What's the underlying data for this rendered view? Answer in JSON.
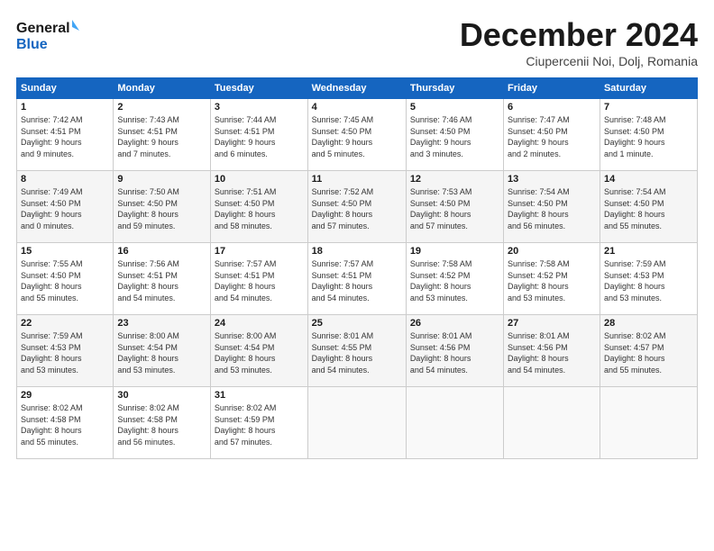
{
  "header": {
    "logo_line1": "General",
    "logo_line2": "Blue",
    "month_title": "December 2024",
    "location": "Ciupercenii Noi, Dolj, Romania"
  },
  "weekdays": [
    "Sunday",
    "Monday",
    "Tuesday",
    "Wednesday",
    "Thursday",
    "Friday",
    "Saturday"
  ],
  "weeks": [
    [
      {
        "day": "1",
        "info": "Sunrise: 7:42 AM\nSunset: 4:51 PM\nDaylight: 9 hours\nand 9 minutes."
      },
      {
        "day": "2",
        "info": "Sunrise: 7:43 AM\nSunset: 4:51 PM\nDaylight: 9 hours\nand 7 minutes."
      },
      {
        "day": "3",
        "info": "Sunrise: 7:44 AM\nSunset: 4:51 PM\nDaylight: 9 hours\nand 6 minutes."
      },
      {
        "day": "4",
        "info": "Sunrise: 7:45 AM\nSunset: 4:50 PM\nDaylight: 9 hours\nand 5 minutes."
      },
      {
        "day": "5",
        "info": "Sunrise: 7:46 AM\nSunset: 4:50 PM\nDaylight: 9 hours\nand 3 minutes."
      },
      {
        "day": "6",
        "info": "Sunrise: 7:47 AM\nSunset: 4:50 PM\nDaylight: 9 hours\nand 2 minutes."
      },
      {
        "day": "7",
        "info": "Sunrise: 7:48 AM\nSunset: 4:50 PM\nDaylight: 9 hours\nand 1 minute."
      }
    ],
    [
      {
        "day": "8",
        "info": "Sunrise: 7:49 AM\nSunset: 4:50 PM\nDaylight: 9 hours\nand 0 minutes."
      },
      {
        "day": "9",
        "info": "Sunrise: 7:50 AM\nSunset: 4:50 PM\nDaylight: 8 hours\nand 59 minutes."
      },
      {
        "day": "10",
        "info": "Sunrise: 7:51 AM\nSunset: 4:50 PM\nDaylight: 8 hours\nand 58 minutes."
      },
      {
        "day": "11",
        "info": "Sunrise: 7:52 AM\nSunset: 4:50 PM\nDaylight: 8 hours\nand 57 minutes."
      },
      {
        "day": "12",
        "info": "Sunrise: 7:53 AM\nSunset: 4:50 PM\nDaylight: 8 hours\nand 57 minutes."
      },
      {
        "day": "13",
        "info": "Sunrise: 7:54 AM\nSunset: 4:50 PM\nDaylight: 8 hours\nand 56 minutes."
      },
      {
        "day": "14",
        "info": "Sunrise: 7:54 AM\nSunset: 4:50 PM\nDaylight: 8 hours\nand 55 minutes."
      }
    ],
    [
      {
        "day": "15",
        "info": "Sunrise: 7:55 AM\nSunset: 4:50 PM\nDaylight: 8 hours\nand 55 minutes."
      },
      {
        "day": "16",
        "info": "Sunrise: 7:56 AM\nSunset: 4:51 PM\nDaylight: 8 hours\nand 54 minutes."
      },
      {
        "day": "17",
        "info": "Sunrise: 7:57 AM\nSunset: 4:51 PM\nDaylight: 8 hours\nand 54 minutes."
      },
      {
        "day": "18",
        "info": "Sunrise: 7:57 AM\nSunset: 4:51 PM\nDaylight: 8 hours\nand 54 minutes."
      },
      {
        "day": "19",
        "info": "Sunrise: 7:58 AM\nSunset: 4:52 PM\nDaylight: 8 hours\nand 53 minutes."
      },
      {
        "day": "20",
        "info": "Sunrise: 7:58 AM\nSunset: 4:52 PM\nDaylight: 8 hours\nand 53 minutes."
      },
      {
        "day": "21",
        "info": "Sunrise: 7:59 AM\nSunset: 4:53 PM\nDaylight: 8 hours\nand 53 minutes."
      }
    ],
    [
      {
        "day": "22",
        "info": "Sunrise: 7:59 AM\nSunset: 4:53 PM\nDaylight: 8 hours\nand 53 minutes."
      },
      {
        "day": "23",
        "info": "Sunrise: 8:00 AM\nSunset: 4:54 PM\nDaylight: 8 hours\nand 53 minutes."
      },
      {
        "day": "24",
        "info": "Sunrise: 8:00 AM\nSunset: 4:54 PM\nDaylight: 8 hours\nand 53 minutes."
      },
      {
        "day": "25",
        "info": "Sunrise: 8:01 AM\nSunset: 4:55 PM\nDaylight: 8 hours\nand 54 minutes."
      },
      {
        "day": "26",
        "info": "Sunrise: 8:01 AM\nSunset: 4:56 PM\nDaylight: 8 hours\nand 54 minutes."
      },
      {
        "day": "27",
        "info": "Sunrise: 8:01 AM\nSunset: 4:56 PM\nDaylight: 8 hours\nand 54 minutes."
      },
      {
        "day": "28",
        "info": "Sunrise: 8:02 AM\nSunset: 4:57 PM\nDaylight: 8 hours\nand 55 minutes."
      }
    ],
    [
      {
        "day": "29",
        "info": "Sunrise: 8:02 AM\nSunset: 4:58 PM\nDaylight: 8 hours\nand 55 minutes."
      },
      {
        "day": "30",
        "info": "Sunrise: 8:02 AM\nSunset: 4:58 PM\nDaylight: 8 hours\nand 56 minutes."
      },
      {
        "day": "31",
        "info": "Sunrise: 8:02 AM\nSunset: 4:59 PM\nDaylight: 8 hours\nand 57 minutes."
      },
      {
        "day": "",
        "info": ""
      },
      {
        "day": "",
        "info": ""
      },
      {
        "day": "",
        "info": ""
      },
      {
        "day": "",
        "info": ""
      }
    ]
  ]
}
